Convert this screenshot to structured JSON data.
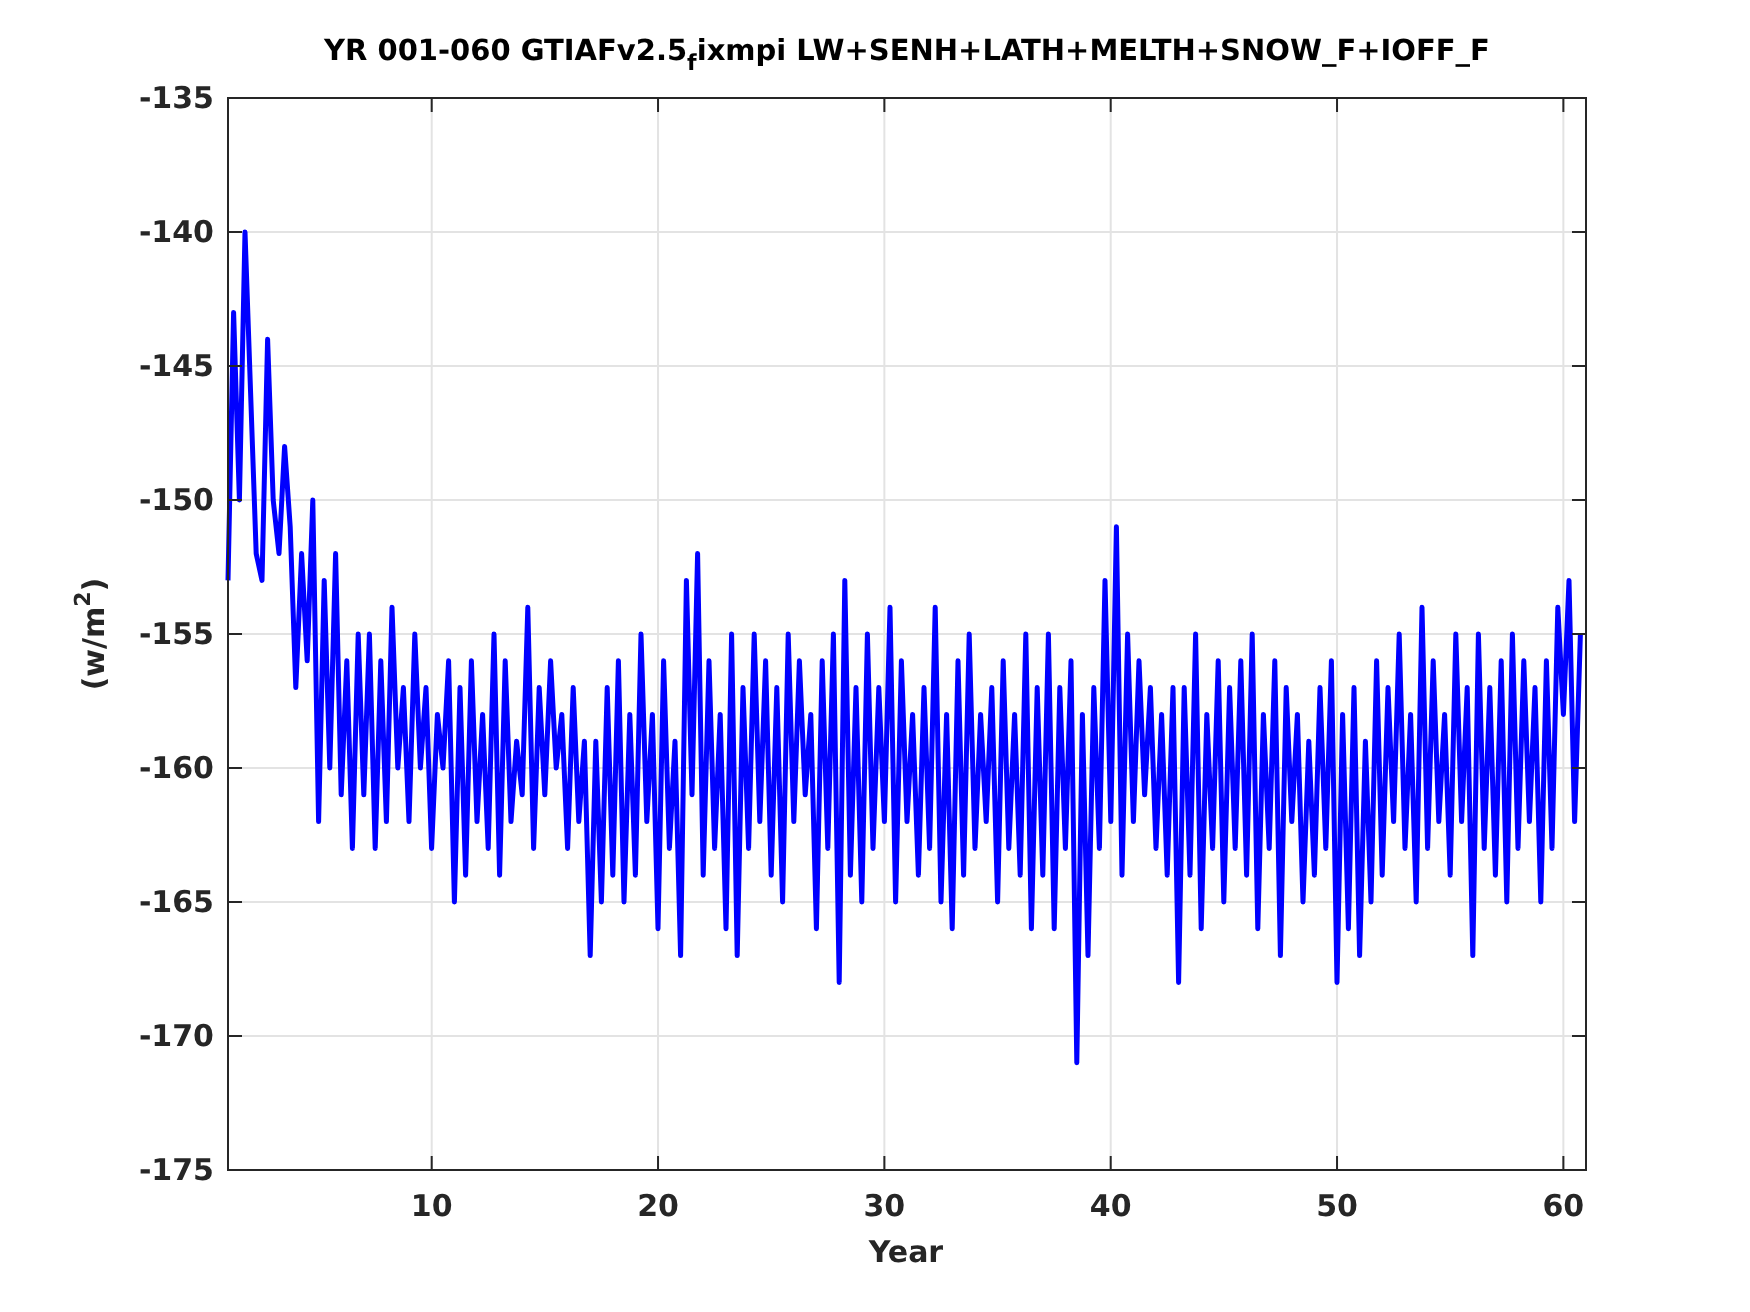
{
  "figure": {
    "chart_data": {
      "type": "line",
      "title": "YR 001-060 GTIAFv2.5$_{f}$ixmpi LW+SENH+LATH+MELTH+SNOW_F+IOFF_F",
      "xlabel": "Year",
      "ylabel": "(w/m$^{2}$)",
      "xlim": [
        1,
        61
      ],
      "ylim": [
        -175,
        -135
      ],
      "xticks": [
        10,
        20,
        30,
        40,
        50,
        60
      ],
      "yticks": [
        -175,
        -170,
        -165,
        -160,
        -155,
        -150,
        -145,
        -140,
        -135
      ],
      "x": [
        1,
        1.25,
        1.5,
        1.75,
        2,
        2.25,
        2.5,
        2.75,
        3,
        3.25,
        3.5,
        3.75,
        4,
        4.25,
        4.5,
        4.75,
        5,
        5.25,
        5.5,
        5.75,
        6,
        6.25,
        6.5,
        6.75,
        7,
        7.25,
        7.5,
        7.75,
        8,
        8.25,
        8.5,
        8.75,
        9,
        9.25,
        9.5,
        9.75,
        10,
        10.25,
        10.5,
        10.75,
        11,
        11.25,
        11.5,
        11.75,
        12,
        12.25,
        12.5,
        12.75,
        13,
        13.25,
        13.5,
        13.75,
        14,
        14.25,
        14.5,
        14.75,
        15,
        15.25,
        15.5,
        15.75,
        16,
        16.25,
        16.5,
        16.75,
        17,
        17.25,
        17.5,
        17.75,
        18,
        18.25,
        18.5,
        18.75,
        19,
        19.25,
        19.5,
        19.75,
        20,
        20.25,
        20.5,
        20.75,
        21,
        21.25,
        21.5,
        21.75,
        22,
        22.25,
        22.5,
        22.75,
        23,
        23.25,
        23.5,
        23.75,
        24,
        24.25,
        24.5,
        24.75,
        25,
        25.25,
        25.5,
        25.75,
        26,
        26.25,
        26.5,
        26.75,
        27,
        27.25,
        27.5,
        27.75,
        28,
        28.25,
        28.5,
        28.75,
        29,
        29.25,
        29.5,
        29.75,
        30,
        30.25,
        30.5,
        30.75,
        31,
        31.25,
        31.5,
        31.75,
        32,
        32.25,
        32.5,
        32.75,
        33,
        33.25,
        33.5,
        33.75,
        34,
        34.25,
        34.5,
        34.75,
        35,
        35.25,
        35.5,
        35.75,
        36,
        36.25,
        36.5,
        36.75,
        37,
        37.25,
        37.5,
        37.75,
        38,
        38.25,
        38.5,
        38.75,
        39,
        39.25,
        39.5,
        39.75,
        40,
        40.25,
        40.5,
        40.75,
        41,
        41.25,
        41.5,
        41.75,
        42,
        42.25,
        42.5,
        42.75,
        43,
        43.25,
        43.5,
        43.75,
        44,
        44.25,
        44.5,
        44.75,
        45,
        45.25,
        45.5,
        45.75,
        46,
        46.25,
        46.5,
        46.75,
        47,
        47.25,
        47.5,
        47.75,
        48,
        48.25,
        48.5,
        48.75,
        49,
        49.25,
        49.5,
        49.75,
        50,
        50.25,
        50.5,
        50.75,
        51,
        51.25,
        51.5,
        51.75,
        52,
        52.25,
        52.5,
        52.75,
        53,
        53.25,
        53.5,
        53.75,
        54,
        54.25,
        54.5,
        54.75,
        55,
        55.25,
        55.5,
        55.75,
        56,
        56.25,
        56.5,
        56.75,
        57,
        57.25,
        57.5,
        57.75,
        58,
        58.25,
        58.5,
        58.75,
        59,
        59.25,
        59.5,
        59.75,
        60,
        60.25,
        60.5,
        60.75
      ],
      "grid": true,
      "series": [
        {
          "color": "#0000ff",
          "values": [
            -153,
            -143,
            -150,
            -140,
            -146,
            -152,
            -153,
            -144,
            -150,
            -152,
            -148,
            -151,
            -157,
            -152,
            -156,
            -150,
            -162,
            -153,
            -160,
            -152,
            -161,
            -156,
            -163,
            -155,
            -161,
            -155,
            -163,
            -156,
            -162,
            -154,
            -160,
            -157,
            -162,
            -155,
            -160,
            -157,
            -163,
            -158,
            -160,
            -156,
            -165,
            -157,
            -164,
            -156,
            -162,
            -158,
            -163,
            -155,
            -164,
            -156,
            -162,
            -159,
            -161,
            -154,
            -163,
            -157,
            -161,
            -156,
            -160,
            -158,
            -163,
            -157,
            -162,
            -159,
            -167,
            -159,
            -165,
            -157,
            -164,
            -156,
            -165,
            -158,
            -164,
            -155,
            -162,
            -158,
            -166,
            -156,
            -163,
            -159,
            -167,
            -153,
            -161,
            -152,
            -164,
            -156,
            -163,
            -158,
            -166,
            -155,
            -167,
            -157,
            -163,
            -155,
            -162,
            -156,
            -164,
            -157,
            -165,
            -155,
            -162,
            -156,
            -161,
            -158,
            -166,
            -156,
            -163,
            -155,
            -168,
            -153,
            -164,
            -157,
            -165,
            -155,
            -163,
            -157,
            -162,
            -154,
            -165,
            -156,
            -162,
            -158,
            -164,
            -157,
            -163,
            -154,
            -165,
            -158,
            -166,
            -156,
            -164,
            -155,
            -163,
            -158,
            -162,
            -157,
            -165,
            -156,
            -163,
            -158,
            -164,
            -155,
            -166,
            -157,
            -164,
            -155,
            -166,
            -157,
            -163,
            -156,
            -171,
            -158,
            -167,
            -157,
            -163,
            -153,
            -162,
            -151,
            -164,
            -155,
            -162,
            -156,
            -161,
            -157,
            -163,
            -158,
            -164,
            -157,
            -168,
            -157,
            -164,
            -155,
            -166,
            -158,
            -163,
            -156,
            -165,
            -157,
            -163,
            -156,
            -164,
            -155,
            -166,
            -158,
            -163,
            -156,
            -167,
            -157,
            -162,
            -158,
            -165,
            -159,
            -164,
            -157,
            -163,
            -156,
            -168,
            -158,
            -166,
            -157,
            -167,
            -159,
            -165,
            -156,
            -164,
            -157,
            -162,
            -155,
            -163,
            -158,
            -165,
            -154,
            -163,
            -156,
            -162,
            -158,
            -164,
            -155,
            -162,
            -157,
            -167,
            -155,
            -163,
            -157,
            -164,
            -156,
            -165,
            -155,
            -163,
            -156,
            -162,
            -157,
            -165,
            -156,
            -163,
            -154,
            -158,
            -153,
            -162,
            -155
          ]
        }
      ]
    }
  }
}
